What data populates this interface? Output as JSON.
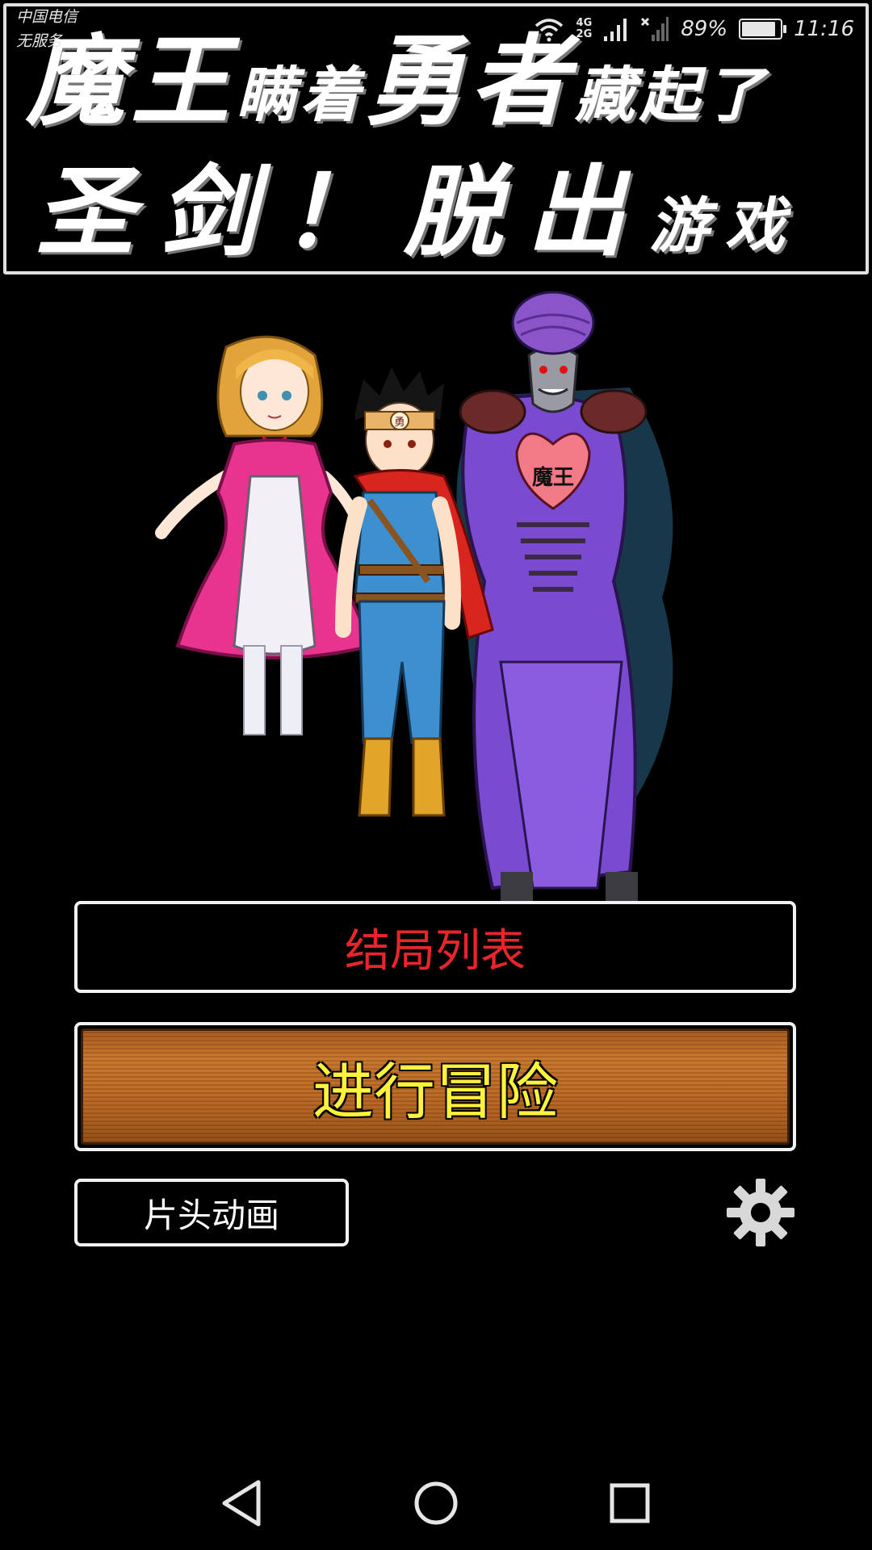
{
  "status_bar": {
    "carrier": "中国电信",
    "service": "无服务",
    "network_top": "4G",
    "network_bottom": "2G",
    "battery_percent": "89%",
    "battery_level": 0.89,
    "time": "11:16"
  },
  "title": {
    "line1": [
      {
        "text": "魔王",
        "size": "big"
      },
      {
        "text": "瞒着",
        "size": "small"
      },
      {
        "text": "勇者",
        "size": "big"
      },
      {
        "text": "藏起了",
        "size": "small"
      }
    ],
    "line2": [
      {
        "text": "圣剑！",
        "size": "big"
      },
      {
        "text": "脱出",
        "size": "big"
      },
      {
        "text": "游戏",
        "size": "small"
      }
    ]
  },
  "characters": {
    "demon_lord_chest_text": "魔王",
    "hero_headband_text": "勇"
  },
  "menu": {
    "endings_label": "结局列表",
    "adventure_label": "进行冒险",
    "intro_label": "片头动画"
  },
  "icons": {
    "settings": "gear-icon",
    "back": "back-icon",
    "home": "home-icon",
    "recent": "recent-apps-icon",
    "wifi": "wifi-icon",
    "signal": "signal-icon",
    "battery": "battery-icon"
  },
  "colors": {
    "endings_text": "#e8252b",
    "adventure_text": "#fff23c",
    "wood": "#b96824",
    "dress_pink": "#e8338f",
    "hero_blue": "#3e8fd0",
    "demon_purple": "#7a4bd0"
  }
}
